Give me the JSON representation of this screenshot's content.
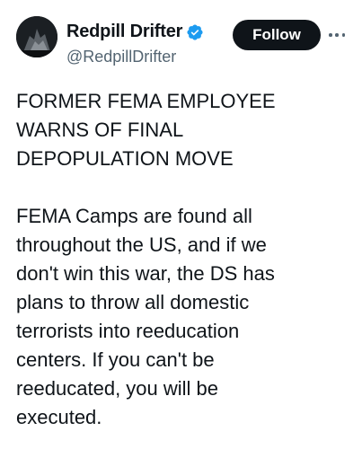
{
  "author": {
    "display_name": "Redpill Drifter",
    "handle": "@RedpillDrifter",
    "verified_icon": "verified-badge-icon",
    "avatar_icon": "avatar"
  },
  "actions": {
    "follow_label": "Follow",
    "more_icon": "more-options-icon"
  },
  "tweet": {
    "headline_lines": [
      "FORMER FEMA EMPLOYEE",
      "WARNS OF FINAL",
      "DEPOPULATION MOVE"
    ],
    "body_lines": [
      "FEMA Camps are found all",
      "throughout the US, and if we",
      "don't win this war, the DS has",
      "plans to throw all domestic",
      "terrorists into reeducation",
      "centers. If you can't be",
      "reeducated, you will be",
      "executed."
    ]
  },
  "colors": {
    "text": "#0f1419",
    "secondary": "#536471",
    "verified": "#1d9bf0",
    "button_bg": "#0f1419",
    "button_text": "#ffffff"
  }
}
